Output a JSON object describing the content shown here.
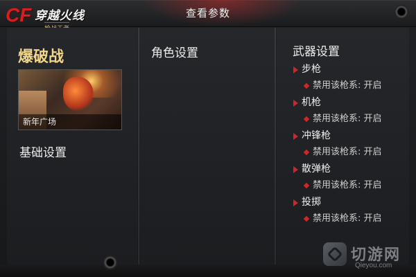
{
  "header": {
    "title": "查看参数",
    "logo": {
      "cf": "CF",
      "name": "穿越火线",
      "sub": "枪战王者"
    }
  },
  "mode": {
    "title": "爆破战",
    "map_name": "新年广场",
    "base_setting": "基础设置"
  },
  "role": {
    "title": "角色设置"
  },
  "weapons": {
    "title": "武器设置",
    "items": [
      {
        "name": "步枪",
        "option": "禁用该枪系: 开启"
      },
      {
        "name": "机枪",
        "option": "禁用该枪系: 开启"
      },
      {
        "name": "冲锋枪",
        "option": "禁用该枪系: 开启"
      },
      {
        "name": "散弹枪",
        "option": "禁用该枪系: 开启"
      },
      {
        "name": "投掷",
        "option": "禁用该枪系: 开启"
      }
    ]
  },
  "watermark": {
    "text": "切游网",
    "sub": "Qieyou.com"
  },
  "colors": {
    "accent_red": "#d02626",
    "mode_gold": "#f1d58a"
  }
}
